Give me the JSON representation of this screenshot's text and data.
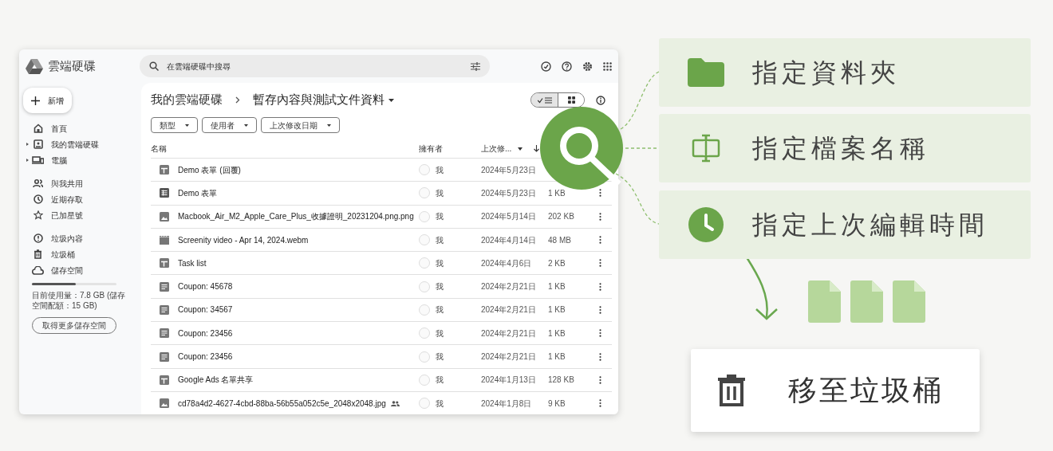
{
  "drive": {
    "app_name": "雲端硬碟",
    "new_button": "新增",
    "nav_groups": [
      [
        {
          "label": "首頁",
          "expandable": false
        },
        {
          "label": "我的雲端硬碟",
          "expandable": true
        },
        {
          "label": "電腦",
          "expandable": true
        }
      ],
      [
        {
          "label": "與我共用",
          "expandable": false
        },
        {
          "label": "近期存取",
          "expandable": false
        },
        {
          "label": "已加星號",
          "expandable": false
        }
      ],
      [
        {
          "label": "垃圾內容",
          "expandable": false
        },
        {
          "label": "垃圾桶",
          "expandable": false
        },
        {
          "label": "儲存空間",
          "expandable": false
        }
      ]
    ],
    "storage": {
      "level": 0.52,
      "text": "目前使用量：7.8 GB (儲存空間配額：15 GB)",
      "button": "取得更多儲存空間"
    },
    "search": {
      "placeholder": "在雲端硬碟中搜尋"
    },
    "breadcrumb": {
      "parent": "我的雲端硬碟",
      "current": "暫存內容與測試文件資料"
    },
    "view_toggle": [
      {
        "kind": "list",
        "selected": true
      },
      {
        "kind": "grid",
        "selected": false
      }
    ],
    "filters": [
      "類型",
      "使用者",
      "上次修改日期"
    ],
    "columns": {
      "name": "名稱",
      "owner": "擁有者",
      "modified": "上次修..."
    },
    "files": [
      {
        "kind": "form",
        "name": "Demo 表單 (回覆)",
        "shared": false,
        "owner": "我",
        "modified": "2024年5月23日"
      },
      {
        "kind": "sheet",
        "name": "Demo 表單",
        "shared": false,
        "owner": "我",
        "modified": "2024年5月23日",
        "size": "1 KB"
      },
      {
        "kind": "image",
        "name": "Macbook_Air_M2_Apple_Care_Plus_收據證明_20231204.png.png",
        "shared": false,
        "owner": "我",
        "modified": "2024年5月14日",
        "size": "202 KB"
      },
      {
        "kind": "video",
        "name": "Screenity video - Apr 14, 2024.webm",
        "shared": false,
        "owner": "我",
        "modified": "2024年4月14日",
        "size": "48 MB"
      },
      {
        "kind": "form",
        "name": "Task list",
        "shared": false,
        "owner": "我",
        "modified": "2024年4月6日",
        "size": "2 KB"
      },
      {
        "kind": "doc",
        "name": "Coupon: 45678",
        "shared": false,
        "owner": "我",
        "modified": "2024年2月21日",
        "size": "1 KB"
      },
      {
        "kind": "doc",
        "name": "Coupon: 34567",
        "shared": false,
        "owner": "我",
        "modified": "2024年2月21日",
        "size": "1 KB"
      },
      {
        "kind": "doc",
        "name": "Coupon: 23456",
        "shared": false,
        "owner": "我",
        "modified": "2024年2月21日",
        "size": "1 KB"
      },
      {
        "kind": "doc",
        "name": "Coupon: 23456",
        "shared": false,
        "owner": "我",
        "modified": "2024年2月21日",
        "size": "1 KB"
      },
      {
        "kind": "form",
        "name": "Google Ads 名單共享",
        "shared": false,
        "owner": "我",
        "modified": "2024年1月13日",
        "size": "128 KB"
      },
      {
        "kind": "image",
        "name": "cd78a4d2-4627-4cbd-88ba-56b55a052c5e_2048x2048.jpg",
        "shared": true,
        "owner": "我",
        "modified": "2024年1月8日",
        "size": "9 KB"
      }
    ]
  },
  "criteria": [
    {
      "kind": "folder",
      "label": "指定資料夾"
    },
    {
      "kind": "rename",
      "label": "指定檔案名稱"
    },
    {
      "kind": "clock",
      "label": "指定上次編輯時間"
    }
  ],
  "action": {
    "label": "移至垃圾桶"
  }
}
